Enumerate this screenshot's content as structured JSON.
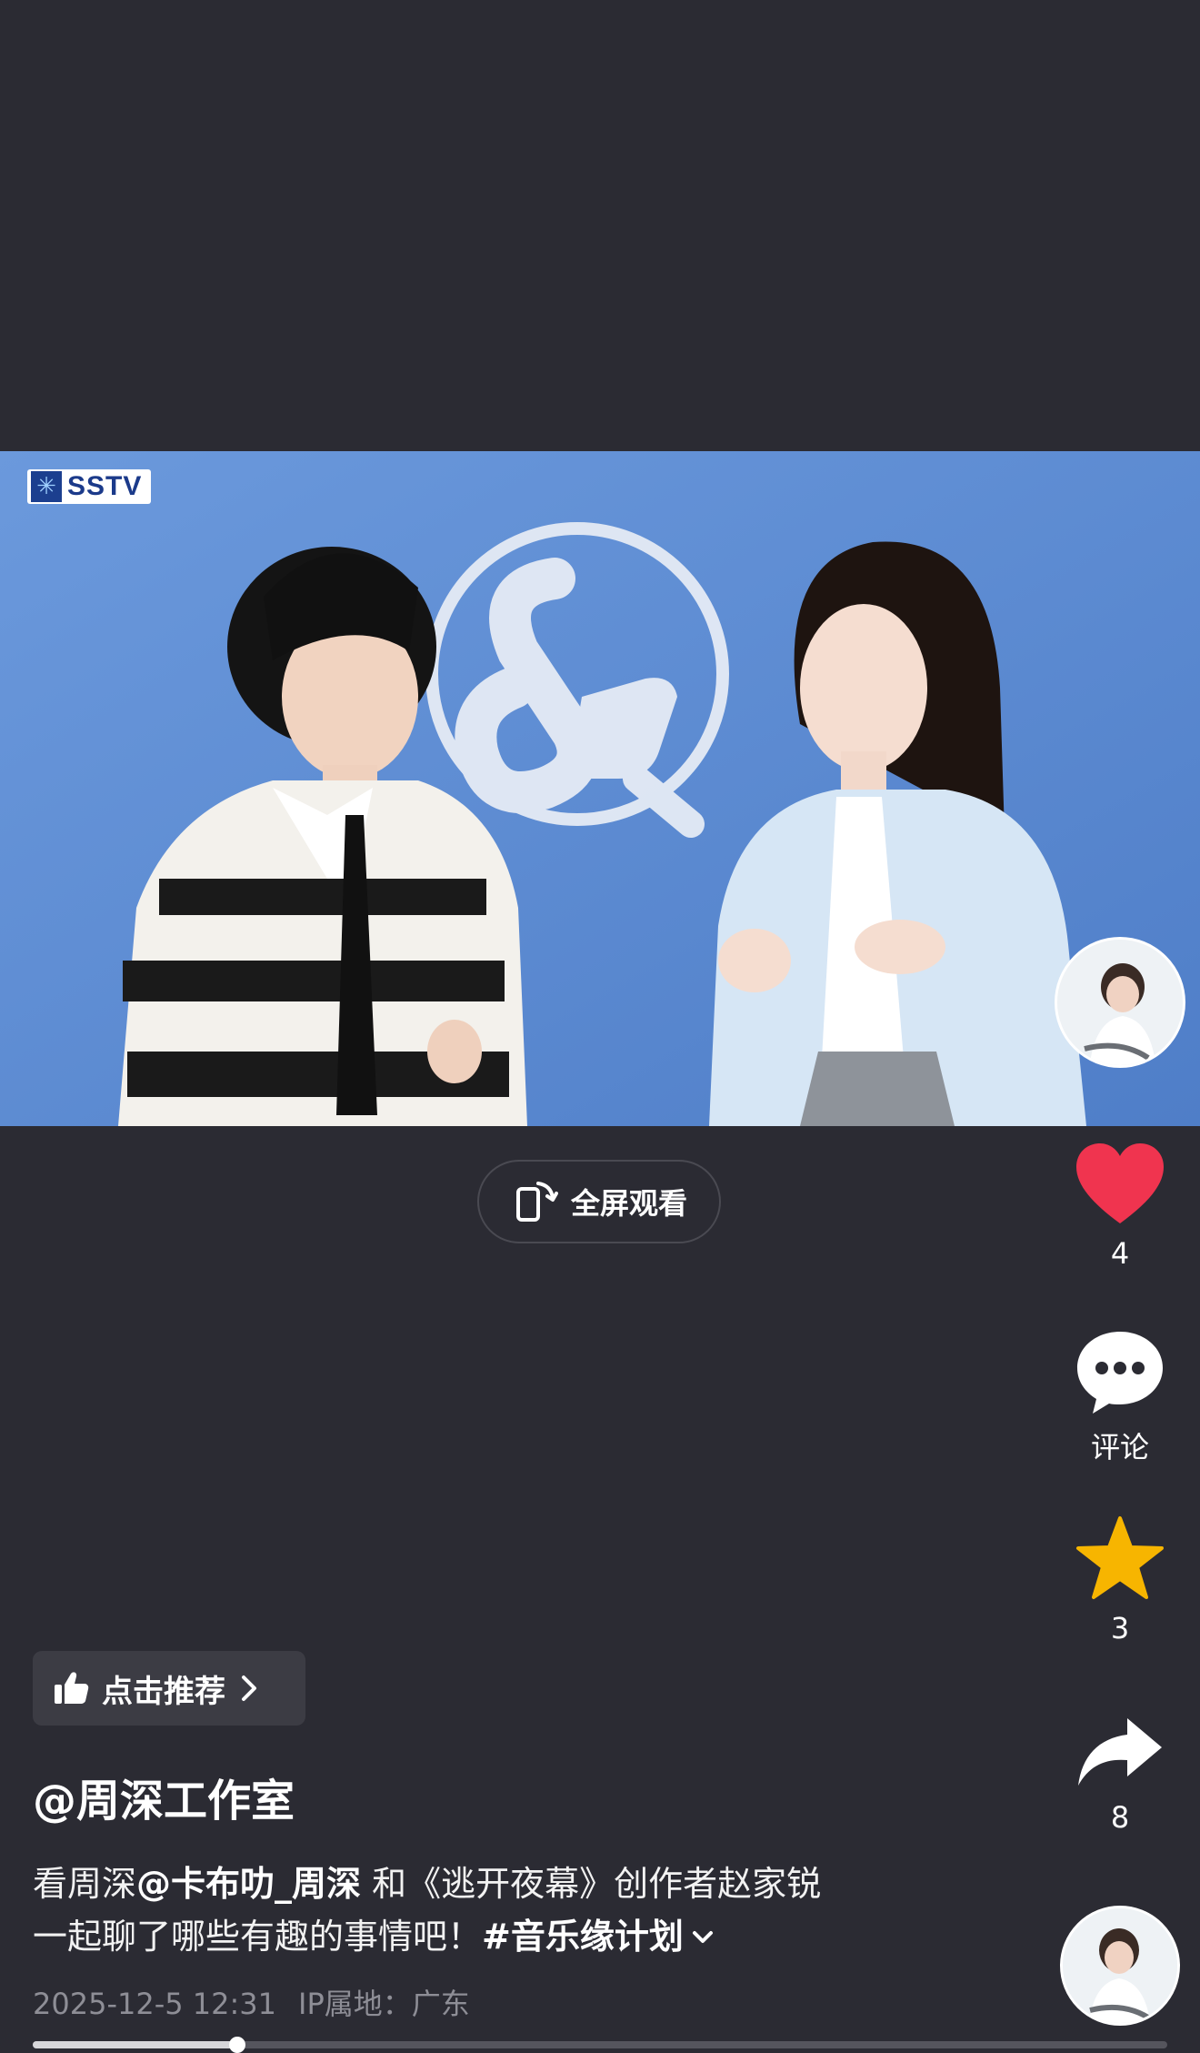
{
  "video": {
    "channel_logo_text": "SSTV"
  },
  "fullscreen_button": {
    "label": "全屏观看",
    "icon": "rotate-phone-icon"
  },
  "actions": {
    "like": {
      "icon": "heart-icon",
      "count": "4",
      "color": "#f0344f"
    },
    "comment": {
      "icon": "comment-bubble-icon",
      "label": "评论"
    },
    "favorite": {
      "icon": "star-icon",
      "count": "3",
      "color": "#f7b500"
    },
    "share": {
      "icon": "share-arrow-icon",
      "count": "8"
    }
  },
  "recommend": {
    "icon": "thumbs-up-icon",
    "label": "点击推荐"
  },
  "post": {
    "author": "@周深工作室",
    "desc_prefix": "看周深",
    "mention": "@卡布叻_周深",
    "desc_mid": " 和《逃开夜幕》创作者赵家锐",
    "desc_line2": "一起聊了哪些有趣的事情吧！",
    "hashtag": "#音乐缘计划",
    "date": "2025-12-5 12:31",
    "ip_location": "IP属地：广东"
  },
  "playback": {
    "progress": 0.18
  }
}
